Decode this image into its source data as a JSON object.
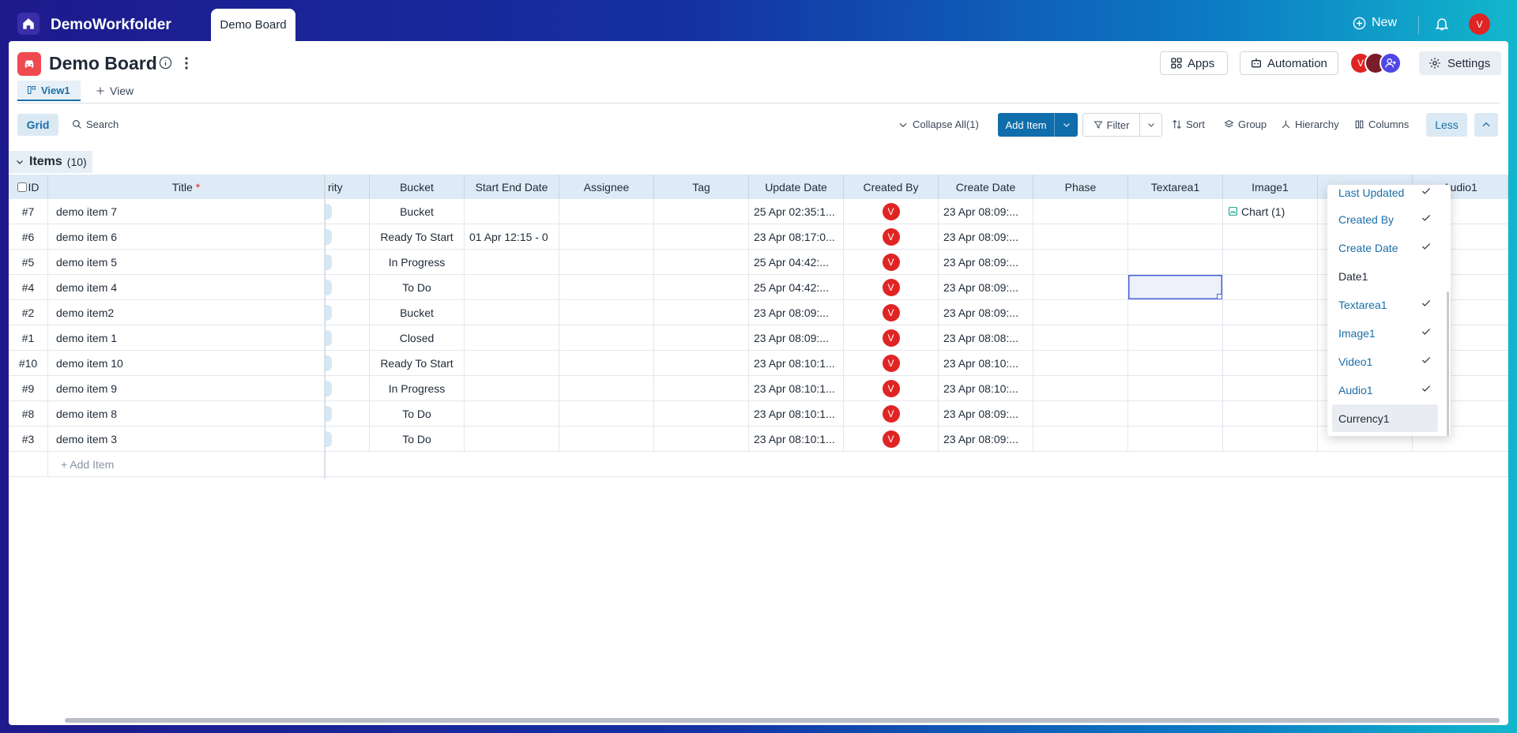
{
  "topbar": {
    "workspace": "DemoWorkfolder",
    "active_tab": "Demo Board",
    "new_label": "New",
    "user_initial": "V"
  },
  "board": {
    "title": "Demo Board"
  },
  "header_buttons": {
    "apps": "Apps",
    "automation": "Automation",
    "settings": "Settings"
  },
  "members": [
    {
      "initial": "V",
      "color": "#e02424"
    },
    {
      "initial": "",
      "color": "#7a1c2a"
    }
  ],
  "view": {
    "tab": "View1",
    "add_view": "View"
  },
  "toolbar": {
    "grid": "Grid",
    "search": "Search",
    "collapse_all": "Collapse All(1)",
    "add_item": "Add Item",
    "filter": "Filter",
    "sort": "Sort",
    "group": "Group",
    "hierarchy": "Hierarchy",
    "columns": "Columns",
    "less": "Less"
  },
  "group": {
    "name": "Items",
    "count": "(10)"
  },
  "columns": {
    "id": "ID",
    "title": "Title",
    "title_required": "*",
    "priority": "rity",
    "bucket": "Bucket",
    "start_end": "Start End Date",
    "assignee": "Assignee",
    "tag": "Tag",
    "update_date": "Update Date",
    "created_by": "Created By",
    "create_date": "Create Date",
    "phase": "Phase",
    "textarea": "Textarea1",
    "image": "Image1",
    "video": "",
    "audio": "Audio1"
  },
  "rows": [
    {
      "id": "#7",
      "title": "demo item 7",
      "bucket": "Bucket",
      "start_end": "",
      "update": "25 Apr 02:35:1...",
      "creator": "V",
      "create": "23 Apr 08:09:...",
      "image": "Chart (1)"
    },
    {
      "id": "#6",
      "title": "demo item 6",
      "bucket": "Ready To Start",
      "start_end": "01 Apr 12:15  -  0",
      "update": "23 Apr 08:17:0...",
      "creator": "V",
      "create": "23 Apr 08:09:...",
      "image": ""
    },
    {
      "id": "#5",
      "title": "demo item 5",
      "bucket": "In Progress",
      "start_end": "",
      "update": "25 Apr 04:42:...",
      "creator": "V",
      "create": "23 Apr 08:09:...",
      "image": ""
    },
    {
      "id": "#4",
      "title": "demo item 4",
      "bucket": "To Do",
      "start_end": "",
      "update": "25 Apr 04:42:...",
      "creator": "V",
      "create": "23 Apr 08:09:...",
      "image": ""
    },
    {
      "id": "#2",
      "title": "demo item2",
      "bucket": "Bucket",
      "start_end": "",
      "update": "23 Apr 08:09:...",
      "creator": "V",
      "create": "23 Apr 08:09:...",
      "image": ""
    },
    {
      "id": "#1",
      "title": "demo item 1",
      "bucket": "Closed",
      "start_end": "",
      "update": "23 Apr 08:09:...",
      "creator": "V",
      "create": "23 Apr 08:08:...",
      "image": ""
    },
    {
      "id": "#10",
      "title": "demo item 10",
      "bucket": "Ready To Start",
      "start_end": "",
      "update": "23 Apr 08:10:1...",
      "creator": "V",
      "create": "23 Apr 08:10:...",
      "image": ""
    },
    {
      "id": "#9",
      "title": "demo item 9",
      "bucket": "In Progress",
      "start_end": "",
      "update": "23 Apr 08:10:1...",
      "creator": "V",
      "create": "23 Apr 08:10:...",
      "image": ""
    },
    {
      "id": "#8",
      "title": "demo item 8",
      "bucket": "To Do",
      "start_end": "",
      "update": "23 Apr 08:10:1...",
      "creator": "V",
      "create": "23 Apr 08:09:...",
      "image": ""
    },
    {
      "id": "#3",
      "title": "demo item 3",
      "bucket": "To Do",
      "start_end": "",
      "update": "23 Apr 08:10:1...",
      "creator": "V",
      "create": "23 Apr 08:09:...",
      "image": ""
    }
  ],
  "add_item_row": "+ Add Item",
  "columns_menu": [
    {
      "label": "Last Updated",
      "checked": true
    },
    {
      "label": "Created By",
      "checked": true
    },
    {
      "label": "Create Date",
      "checked": true
    },
    {
      "label": "Date1",
      "checked": false
    },
    {
      "label": "Textarea1",
      "checked": true
    },
    {
      "label": "Image1",
      "checked": true
    },
    {
      "label": "Video1",
      "checked": true
    },
    {
      "label": "Audio1",
      "checked": true
    },
    {
      "label": "Currency1",
      "checked": false
    }
  ],
  "colors": {
    "accent": "#1b6fa8",
    "avatar": "#e02424",
    "board_icon": "#ef4a4f"
  }
}
